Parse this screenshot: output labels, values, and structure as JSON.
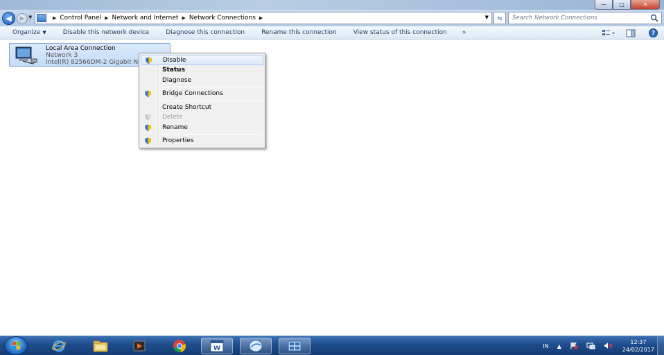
{
  "window": {
    "minimize": "—",
    "maximize": "□",
    "close": "✕"
  },
  "address": {
    "crumbs": [
      "Control Panel",
      "Network and Internet",
      "Network Connections"
    ]
  },
  "search": {
    "placeholder": "Search Network Connections"
  },
  "commandbar": {
    "organize": "Organize",
    "disable": "Disable this network device",
    "diagnose": "Diagnose this connection",
    "rename": "Rename this connection",
    "view_status": "View status of this connection",
    "more": "»"
  },
  "connection": {
    "name": "Local Area Connection",
    "network": "Network 3",
    "adapter": "Intel(R) 82566DM-2 Gigabit Network Connection"
  },
  "context_menu": {
    "disable": "Disable",
    "status": "Status",
    "diagnose": "Diagnose",
    "bridge": "Bridge Connections",
    "shortcut": "Create Shortcut",
    "delete": "Delete",
    "rename": "Rename",
    "properties": "Properties"
  },
  "taskbar": {
    "lang": "IN",
    "tray_arrow": "▲",
    "time": "12:37",
    "date": "24/02/2017"
  }
}
